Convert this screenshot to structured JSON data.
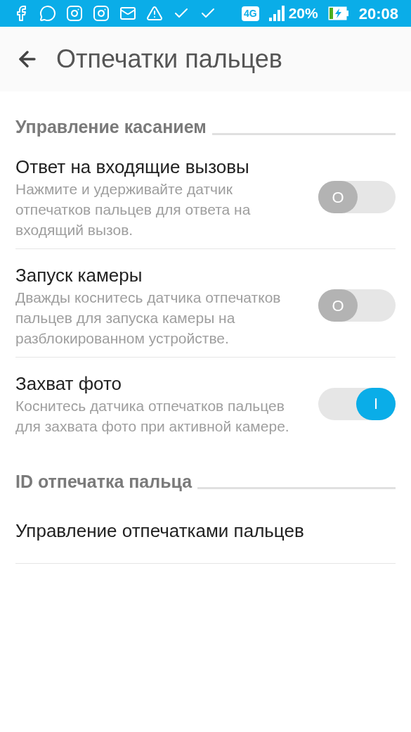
{
  "status_bar": {
    "network": "4G",
    "battery": "20%",
    "time": "20:08"
  },
  "header": {
    "title": "Отпечатки пальцев"
  },
  "sections": [
    {
      "title": "Управление касанием",
      "items": [
        {
          "kind": "toggle",
          "title": "Ответ на входящие вызовы",
          "description": "Нажмите и удерживайте датчик отпечатков пальцев для ответа на входящий вызов.",
          "on": false,
          "thumb_label": "O"
        },
        {
          "kind": "toggle",
          "title": "Запуск камеры",
          "description": "Дважды коснитесь датчика отпечатков пальцев для запуска камеры на разблокированном устройстве.",
          "on": false,
          "thumb_label": "O"
        },
        {
          "kind": "toggle",
          "title": "Захват фото",
          "description": "Коснитесь датчика отпечатков пальцев для захвата фото при активной камере.",
          "on": true,
          "thumb_label": "I"
        }
      ]
    },
    {
      "title": "ID отпечатка пальца",
      "items": [
        {
          "kind": "link",
          "title": "Управление отпечатками пальцев"
        }
      ]
    }
  ]
}
